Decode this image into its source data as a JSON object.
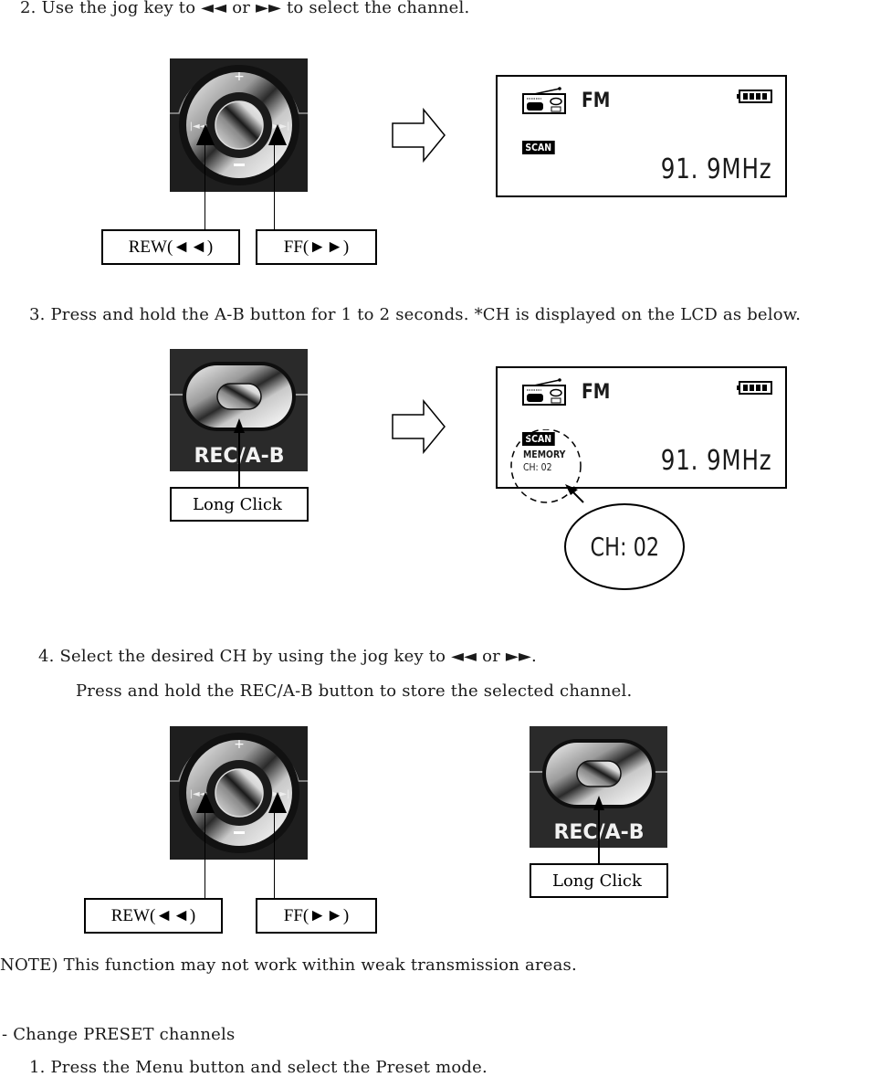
{
  "step2": {
    "text": "2. Use the jog key to ◄◄ or ►► to select the channel.",
    "rew_label": "REW(◄◄)",
    "ff_label": "FF(►►)",
    "lcd": {
      "mode": "FM",
      "scan_badge": "SCAN",
      "frequency": "91. 9MHz"
    }
  },
  "step3": {
    "text": "3.   Press and hold the A-B button for 1 to 2 seconds. *CH is displayed on the LCD as below.",
    "button_label": "REC/A-B",
    "action_label": "Long Click",
    "lcd": {
      "mode": "FM",
      "scan_badge": "SCAN",
      "memory_label": "MEMORY",
      "channel_small": "CH: 02",
      "frequency": "91. 9MHz"
    },
    "callout": "CH: 02"
  },
  "step4": {
    "line1": "4.   Select the desired CH by using the jog key to ◄◄ or ►►.",
    "line2": "Press and hold the REC/A-B button to store the selected channel.",
    "rew_label": "REW(◄◄)",
    "ff_label": "FF(►►)",
    "button_label": "REC/A-B",
    "action_label": "Long Click"
  },
  "note": "NOTE) This function may not work within weak transmission areas.",
  "section": {
    "heading": "- Change PRESET channels",
    "step1": "1. Press the Menu button and select the Preset mode."
  },
  "icons": {
    "battery_level_fraction": 1.0,
    "battery_bars": 4
  }
}
